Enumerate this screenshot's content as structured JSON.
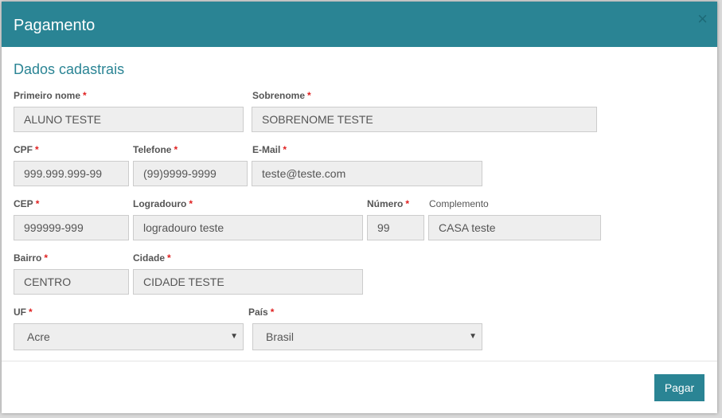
{
  "modal": {
    "title": "Pagamento",
    "close_symbol": "×",
    "section_title": "Dados cadastrais"
  },
  "required_mark": "*",
  "fields": {
    "first_name": {
      "label": "Primeiro nome",
      "value": "ALUNO TESTE"
    },
    "last_name": {
      "label": "Sobrenome",
      "value": "SOBRENOME TESTE"
    },
    "cpf": {
      "label": "CPF",
      "value": "999.999.999-99"
    },
    "phone": {
      "label": "Telefone",
      "value": "(99)9999-9999"
    },
    "email": {
      "label": "E-Mail",
      "value": "teste@teste.com"
    },
    "cep": {
      "label": "CEP",
      "value": "999999-999"
    },
    "street": {
      "label": "Logradouro",
      "value": "logradouro teste"
    },
    "number": {
      "label": "Número",
      "value": "99"
    },
    "complement": {
      "label": "Complemento",
      "value": "CASA teste"
    },
    "neighborhood": {
      "label": "Bairro",
      "value": "CENTRO"
    },
    "city": {
      "label": "Cidade",
      "value": "CIDADE TESTE"
    },
    "state": {
      "label": "UF",
      "selected": "Acre"
    },
    "country": {
      "label": "País",
      "selected": "Brasil"
    }
  },
  "footer": {
    "pay_label": "Pagar"
  },
  "colors": {
    "accent": "#2a8494",
    "required": "#e02020"
  },
  "icons": {
    "close": "close-icon",
    "dropdown": "chevron-down-icon"
  }
}
